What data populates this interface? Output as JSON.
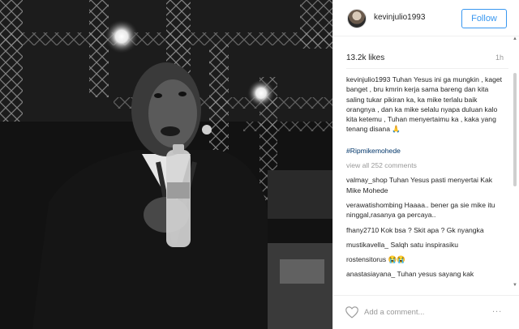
{
  "header": {
    "username": "kevinjulio1993",
    "follow_label": "Follow"
  },
  "stats": {
    "likes": "13.2k likes",
    "age": "1h"
  },
  "caption": {
    "username": "kevinjulio1993",
    "text": "Tuhan Yesus ini ga mungkin , kaget banget , bru kmrin kerja sama bareng dan kita saling tukar pikiran ka, ka mike terlalu baik orangnya , dan ka mike selalu nyapa duluan kalo kita ketemu , Tuhan menyertaimu ka , kaka yang tenang disana 🙏",
    "hashtag": "#Ripmikemohede"
  },
  "view_all": "view all 252 comments",
  "comments": [
    {
      "user": "valmay_shop",
      "text": "Tuhan Yesus pasti menyertai Kak Mike Mohede"
    },
    {
      "user": "verawatishombing",
      "text": "Haaaa.. bener ga sie mike itu ninggal,rasanya ga percaya.."
    },
    {
      "user": "fhany2710",
      "text": "Kok bsa ? Skit apa ? Gk nyangka"
    },
    {
      "user": "mustikavella_",
      "text": "Salqh satu inspirasiku"
    },
    {
      "user": "rostensitorus",
      "text": "😭😭"
    },
    {
      "user": "anastasiayana_",
      "text": "Tuhan yesus sayang kak"
    }
  ],
  "footer": {
    "add_comment_placeholder": "Add a comment...",
    "more_label": "..."
  },
  "icons": {
    "heart": "heart-icon",
    "more": "more-options-icon",
    "scroll_up": "scroll-up-icon",
    "scroll_down": "scroll-down-icon"
  },
  "colors": {
    "accent": "#3897f0",
    "hashtag": "#003569",
    "muted": "#999999"
  }
}
